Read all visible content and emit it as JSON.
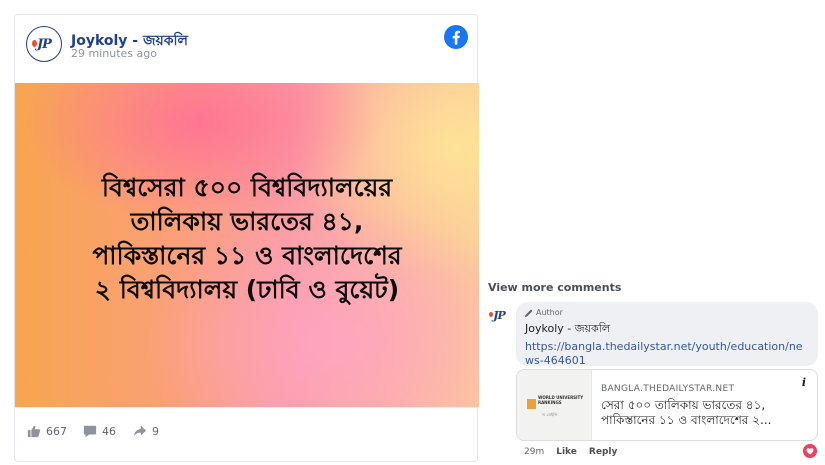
{
  "post": {
    "page_name": "Joykoly - জয়কলি",
    "time": "29 minutes ago",
    "logo_text": "JP",
    "image_text": "বিশ্বসেরা ৫০০ বিশ্ববিদ্যালয়ের\nতালিকায় ভারতের ৪১,\nপাকিস্তানের ১১ ও বাংলাদেশের\n২ বিশ্ববিদ্যালয় (ঢাবি ও বুয়েট)",
    "likes": "667",
    "comments": "46",
    "shares": "9",
    "icons": {
      "platform": "facebook-icon",
      "like": "thumbs-up-icon",
      "comment": "comment-icon",
      "share": "share-icon"
    },
    "colors": {
      "brand": "#1f3f8f",
      "facebook": "#1877f2"
    }
  },
  "comments": {
    "view_more": "View more comments",
    "comment": {
      "author_tag": "Author",
      "name": "Joykoly - জয়কলি",
      "link": "https://bangla.thedailystar.net/youth/education/news-464601",
      "preview": {
        "domain": "BANGLA.THEDAILYSTAR.NET",
        "title": "সেরা ৫০০ তালিকায় ভারতের ৪১, পাকিস্তানের ১১ ও বাংলাদেশের ২...",
        "thumb_text": "WORLD UNIVERSITY RANKINGS",
        "thumb_sub": "দ্য ডেইলি"
      },
      "time": "29m",
      "like_label": "Like",
      "reply_label": "Reply"
    }
  }
}
